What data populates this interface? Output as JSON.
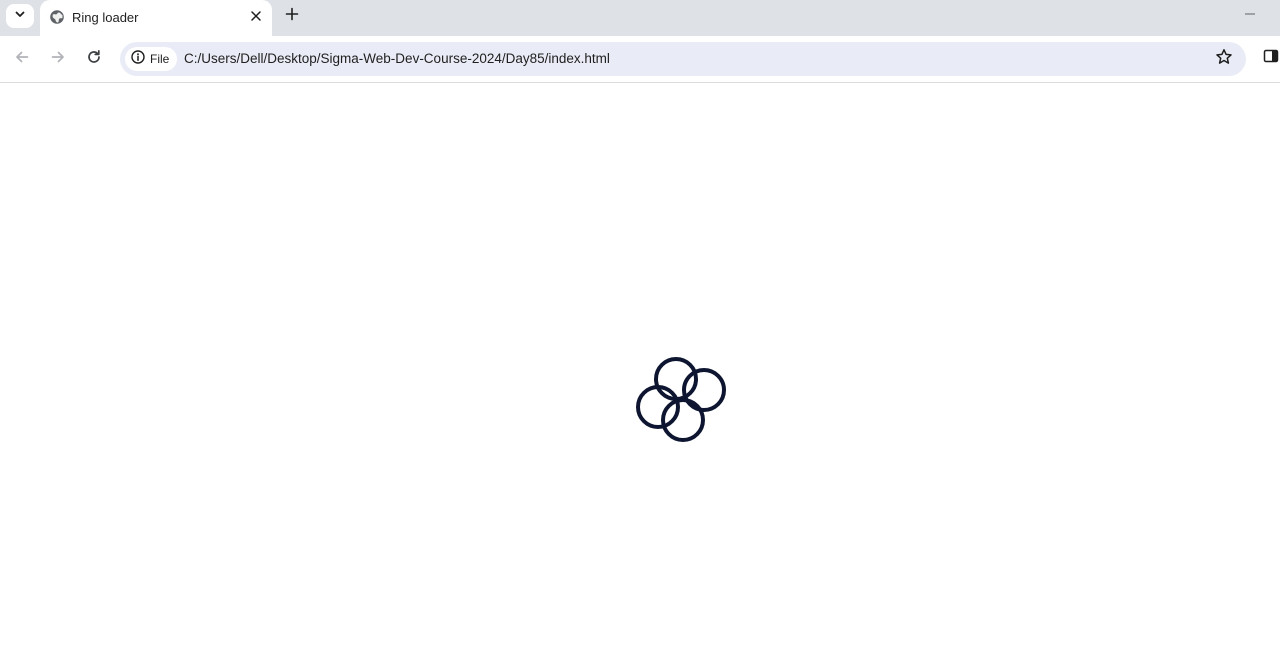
{
  "browser": {
    "tab": {
      "title": "Ring loader",
      "favicon": "globe-icon"
    },
    "omnibox": {
      "site_chip_label": "File",
      "url": "C:/Users/Dell/Desktop/Sigma-Web-Dev-Course-2024/Day85/index.html"
    },
    "icons": {
      "tab_search": "chevron-down-icon",
      "tab_close": "close-icon",
      "new_tab": "plus-icon",
      "minimize": "minimize-icon",
      "back": "arrow-left-icon",
      "forward": "arrow-right-icon",
      "reload": "reload-icon",
      "site_info": "info-icon",
      "bookmark": "star-icon",
      "side_panel": "side-panel-icon"
    }
  },
  "page": {
    "loader": {
      "ring_count": 4,
      "ring_color": "#0d1530"
    }
  },
  "colors": {
    "tabstrip_bg": "#dee1e6",
    "omnibox_bg": "#e9ecf6",
    "page_bg": "#ffffff"
  }
}
